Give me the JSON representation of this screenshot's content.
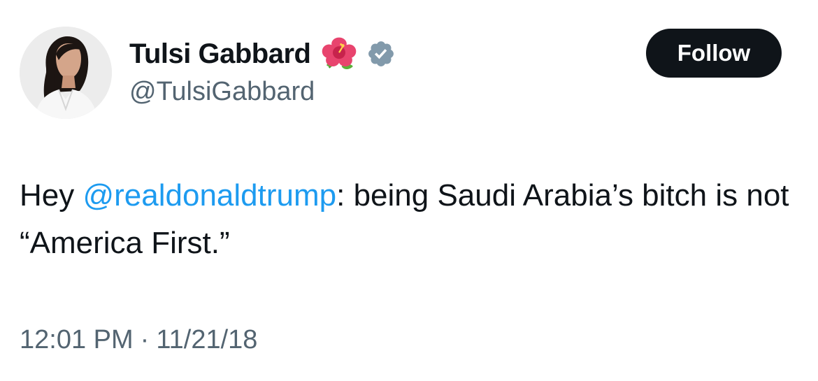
{
  "author": {
    "display_name": "Tulsi Gabbard",
    "handle": "@TulsiGabbard",
    "name_emoji_icon": "hibiscus-flower-icon",
    "verified_icon": "verified-badge-icon",
    "avatar_icon": "profile-photo-avatar"
  },
  "follow": {
    "label": "Follow",
    "bg_color": "#0f1419",
    "text_color": "#ffffff"
  },
  "tweet": {
    "text_before": "Hey ",
    "mention": "@realdonaldtrump",
    "text_after": ": being Saudi Arabia’s bitch is not “America First.”",
    "time": "12:01 PM",
    "separator": "·",
    "date": "11/21/18"
  },
  "colors": {
    "text": "#0f1419",
    "secondary": "#536471",
    "link": "#1d9bf0",
    "verified_badge": "#829aab"
  }
}
